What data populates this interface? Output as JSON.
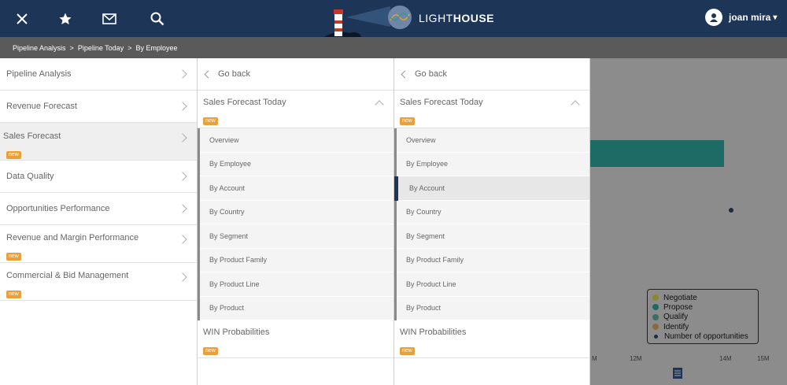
{
  "colors": {
    "topbar": "#1d3557",
    "crumbbar": "#5a5a5a",
    "badge": "#e8a13a",
    "active_marker": "#1d3557"
  },
  "topbar": {
    "icons": [
      "close-icon",
      "star-icon",
      "mail-icon",
      "search-icon"
    ],
    "brand_light": "LIGHT",
    "brand_bold": "HOUSE",
    "user_name": "joan mira",
    "user_caret": "▾"
  },
  "breadcrumb": [
    "Pipeline Analysis",
    "Pipeline Today",
    "By Employee"
  ],
  "breadcrumb_sep": ">",
  "main_menu": [
    {
      "label": "Pipeline Analysis",
      "badge": ""
    },
    {
      "label": "Revenue Forecast",
      "badge": ""
    },
    {
      "label": "Sales Forecast",
      "badge": "new"
    },
    {
      "label": "Data Quality",
      "badge": ""
    },
    {
      "label": "Opportunities Performance",
      "badge": ""
    },
    {
      "label": "Revenue and Margin Performance",
      "badge": "new"
    },
    {
      "label": "Commercial & Bid Management",
      "badge": "new"
    }
  ],
  "submenu": {
    "go_back": "Go back",
    "section": "Sales Forecast Today",
    "section_badge": "new",
    "items": [
      "Overview",
      "By Employee",
      "By Account",
      "By Country",
      "By Segment",
      "By Product Family",
      "By Product Line",
      "By Product"
    ],
    "win_label": "WIN Probabilities",
    "win_badge": "new"
  },
  "submenu_right_selected": "By Account",
  "chart": {
    "legend": [
      {
        "label": "Negotiate",
        "color": "#8a8a2a"
      },
      {
        "label": "Propose",
        "color": "#1e6b66"
      },
      {
        "label": "Qualify",
        "color": "#3a6f63"
      },
      {
        "label": "Identify",
        "color": "#8a6a3a"
      },
      {
        "label": "Number of opportunities",
        "color": "#1a2c45"
      }
    ],
    "ticks": [
      "M",
      "12M",
      "14M",
      "15M"
    ]
  }
}
